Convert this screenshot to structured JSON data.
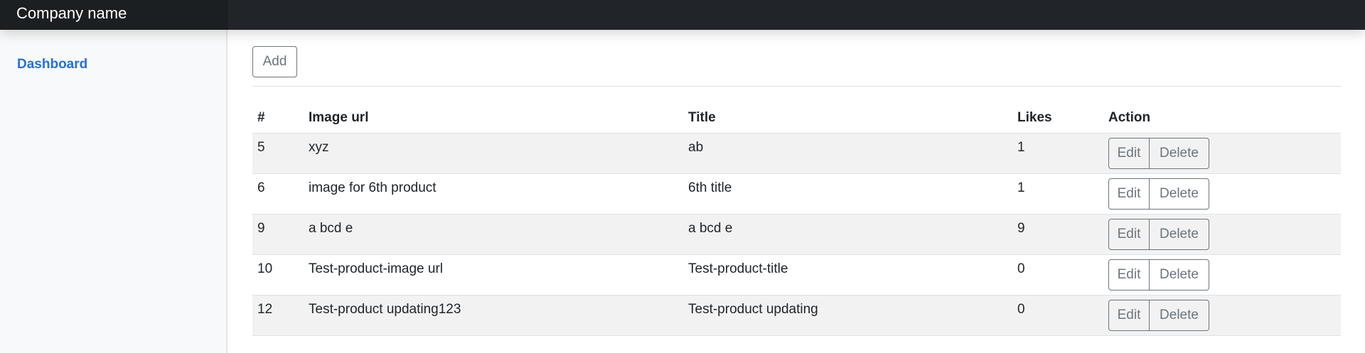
{
  "header": {
    "brand": "Company name"
  },
  "sidebar": {
    "items": [
      {
        "label": "Dashboard"
      }
    ]
  },
  "toolbar": {
    "add_label": "Add"
  },
  "table": {
    "columns": [
      "#",
      "Image url",
      "Title",
      "Likes",
      "Action"
    ],
    "edit_label": "Edit",
    "delete_label": "Delete",
    "rows": [
      {
        "id": "5",
        "image_url": "xyz",
        "title": "ab",
        "likes": "1"
      },
      {
        "id": "6",
        "image_url": "image for 6th product",
        "title": "6th title",
        "likes": "1"
      },
      {
        "id": "9",
        "image_url": "a bcd e",
        "title": "a bcd e",
        "likes": "9"
      },
      {
        "id": "10",
        "image_url": "Test-product-image url",
        "title": "Test-product-title",
        "likes": "0"
      },
      {
        "id": "12",
        "image_url": "Test-product updating123",
        "title": "Test-product updating",
        "likes": "0"
      }
    ]
  },
  "colors": {
    "topbar": "#212529",
    "sidebar_bg": "#f8f9fa",
    "link": "#2470dc",
    "button_outline": "#6c757d",
    "stripe": "#f2f2f2"
  }
}
